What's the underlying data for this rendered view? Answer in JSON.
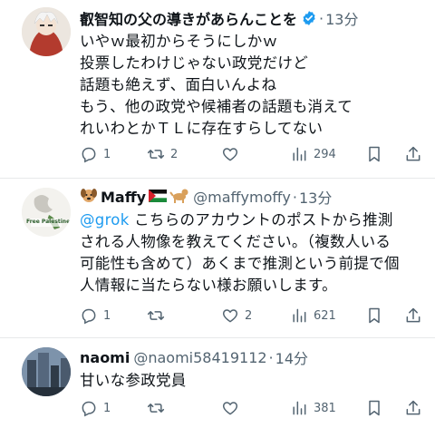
{
  "tweets": [
    {
      "name": "叡智知の父の導きがあらんことを",
      "handle": "",
      "time": "13分",
      "lines": [
        "いやｗ最初からそうにしかｗ",
        "投票したわけじゃない政党だけど",
        "話題も絶えず、面白いんよね",
        "もう、他の政党や候補者の話題も消えて",
        "れいわとかＴＬに存在すらしてない"
      ],
      "replies": "1",
      "retweets": "2",
      "likes": "",
      "views": "294"
    },
    {
      "name": "Maffy",
      "handle": "@maffymoffy",
      "time": "13分",
      "avatar_text": "Free Palestine",
      "mention": "@grok",
      "first_line_rest": " こちらのアカウントのポストから推測",
      "lines": [
        "される人物像を教えてください。（複数人いる",
        "可能性も含めて）あくまで推測という前提で個",
        "人情報に当たらない様お願いします。"
      ],
      "replies": "1",
      "retweets": "",
      "likes": "2",
      "views": "621"
    },
    {
      "name": "naomi",
      "handle": "@naomi58419112",
      "time": "14分",
      "lines": [
        "甘いな参政党員"
      ],
      "replies": "1",
      "retweets": "",
      "likes": "",
      "views": "381"
    }
  ],
  "colors": {
    "text": "#0f1419",
    "muted": "#536471",
    "link": "#1d9bf0",
    "verified": "#1d9bf0",
    "divider": "#e7e9ea"
  },
  "icons": [
    "reply-icon",
    "retweet-icon",
    "like-icon",
    "views-icon",
    "bookmark-icon",
    "share-icon"
  ]
}
